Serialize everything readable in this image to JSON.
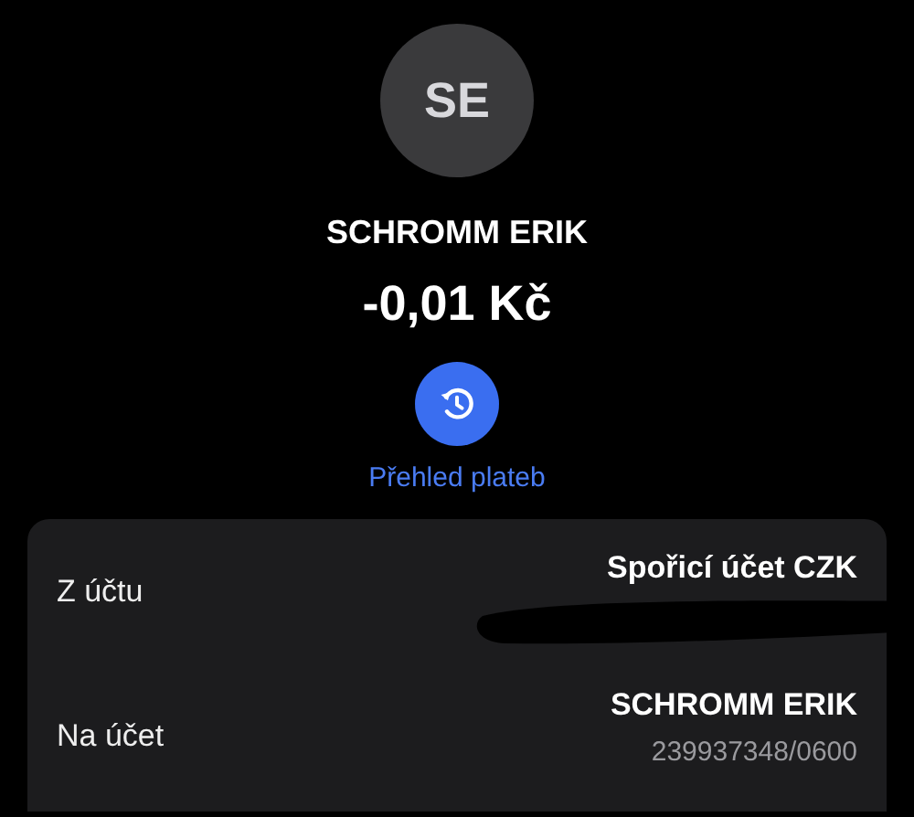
{
  "avatar": {
    "initials": "SE"
  },
  "payee": "SCHROMM ERIK",
  "amount": "-0,01 Kč",
  "history_link": {
    "label": "Přehled plateb"
  },
  "details": [
    {
      "label": "Z účtu",
      "value": "Spořicí účet CZK",
      "redacted": true
    },
    {
      "label": "Na účet",
      "value": "SCHROMM ERIK",
      "detail": "239937348/0600"
    }
  ]
}
